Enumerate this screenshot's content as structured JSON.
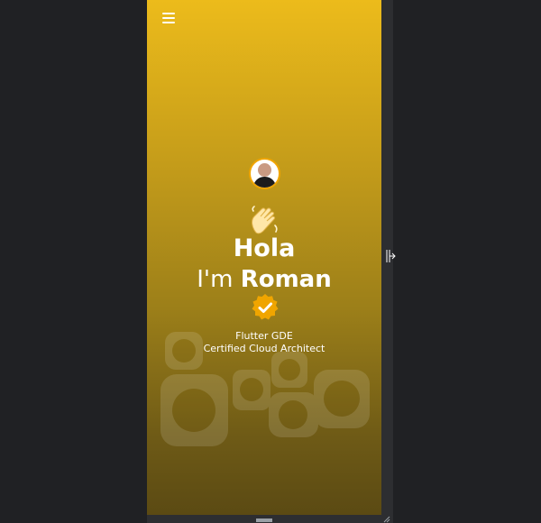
{
  "app": {
    "menu_icon": "hamburger-menu-icon",
    "greeting": "Hola",
    "intro_prefix": "I'm ",
    "name": "Roman",
    "subtitle_line1": "Flutter GDE",
    "subtitle_line2": "Certified Cloud Architect",
    "avatar_icon": "profile-avatar",
    "wave_icon": "waving-hand-icon",
    "badge_icon": "verified-badge-icon"
  },
  "colors": {
    "gradient_top": "#ecbb1b",
    "gradient_bottom": "#5b4a13",
    "badge": "#f0a500",
    "window_bg": "#202124"
  }
}
